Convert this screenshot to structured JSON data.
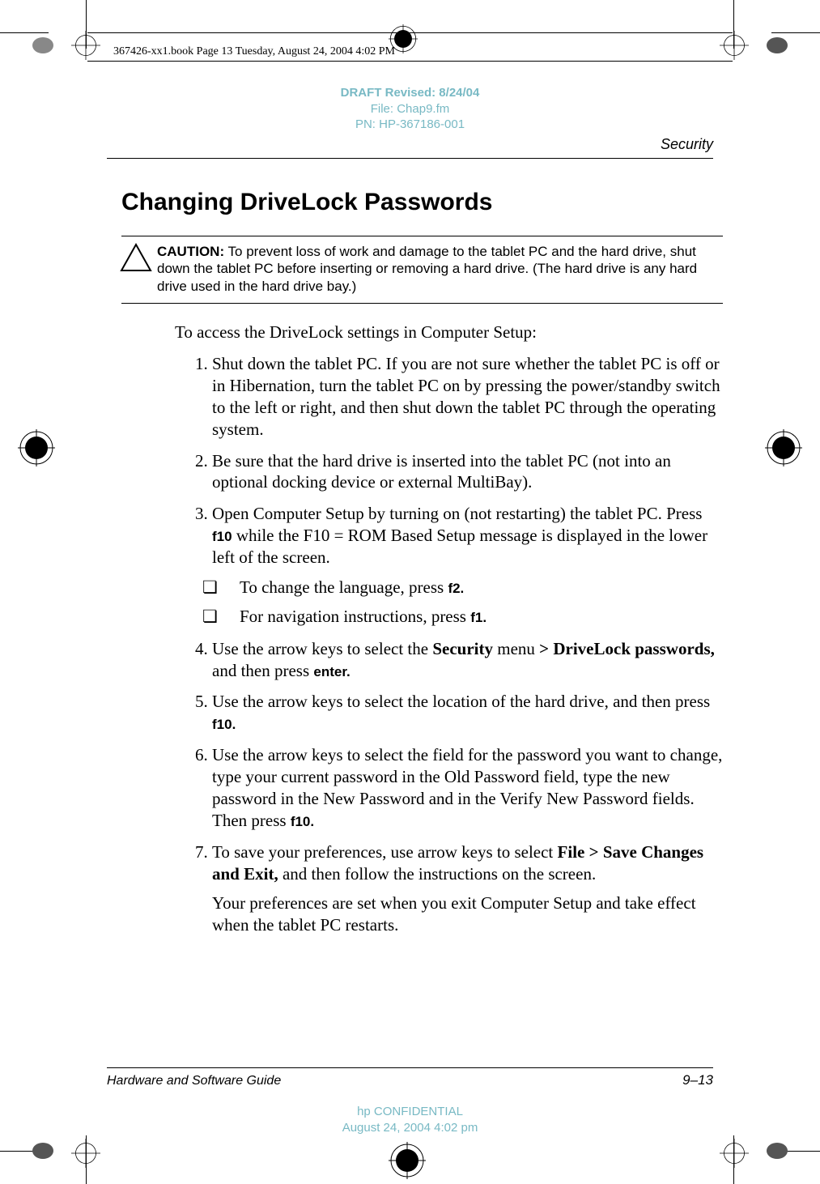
{
  "meta": {
    "book_line": "367426-xx1.book  Page 13  Tuesday, August 24, 2004  4:02 PM"
  },
  "draft": {
    "line1": "DRAFT Revised: 8/24/04",
    "line2": "File: Chap9.fm",
    "line3": "PN: HP-367186-001"
  },
  "header": {
    "section": "Security"
  },
  "heading": "Changing DriveLock Passwords",
  "caution": {
    "label": "CAUTION:",
    "text": " To prevent loss of work and damage to the tablet PC and the hard drive, shut down the tablet PC before inserting or removing a hard drive. (The hard drive is any hard drive used in the hard drive bay.)"
  },
  "intro": "To access the DriveLock settings in Computer Setup:",
  "steps": {
    "s1": "Shut down the tablet PC. If you are not sure whether the tablet PC is off or in Hibernation, turn the tablet PC on by pressing the power/standby switch to the left or right, and then shut down the tablet PC through the operating system.",
    "s2": "Be sure that the hard drive is inserted into the tablet PC (not into an optional docking device or external MultiBay).",
    "s3a": "Open Computer Setup by turning on (not restarting) the tablet PC. Press ",
    "s3_key": "f10",
    "s3b": " while the F10 = ROM Based Setup message is displayed in the lower left of the screen.",
    "s3_sub1a": "To change the language, press ",
    "s3_sub1_key": "f2.",
    "s3_sub2a": "For navigation instructions, press ",
    "s3_sub2_key": "f1.",
    "s4a": "Use the arrow keys to select the ",
    "s4_menu": "Security",
    "s4b": " menu ",
    "s4_path": "> DriveLock passwords,",
    "s4c": " and then press ",
    "s4_key": "enter.",
    "s5a": "Use the arrow keys to select the location of the hard drive, and then press ",
    "s5_key": "f10.",
    "s6a": "Use the arrow keys to select the field for the password you want to change, type your current password in the Old Password field, type the new password in the New Password and in the Verify New Password fields. Then press ",
    "s6_key": "f10.",
    "s7a": "To save your preferences, use arrow keys to select ",
    "s7_path": "File > Save Changes and Exit,",
    "s7b": " and then follow the instructions on the screen.",
    "s7_note": "Your preferences are set when you exit Computer Setup and take effect when the tablet PC restarts."
  },
  "footer": {
    "left": "Hardware and Software Guide",
    "right": "9–13",
    "conf1": "hp CONFIDENTIAL",
    "conf2": "August 24, 2004 4:02 pm"
  }
}
